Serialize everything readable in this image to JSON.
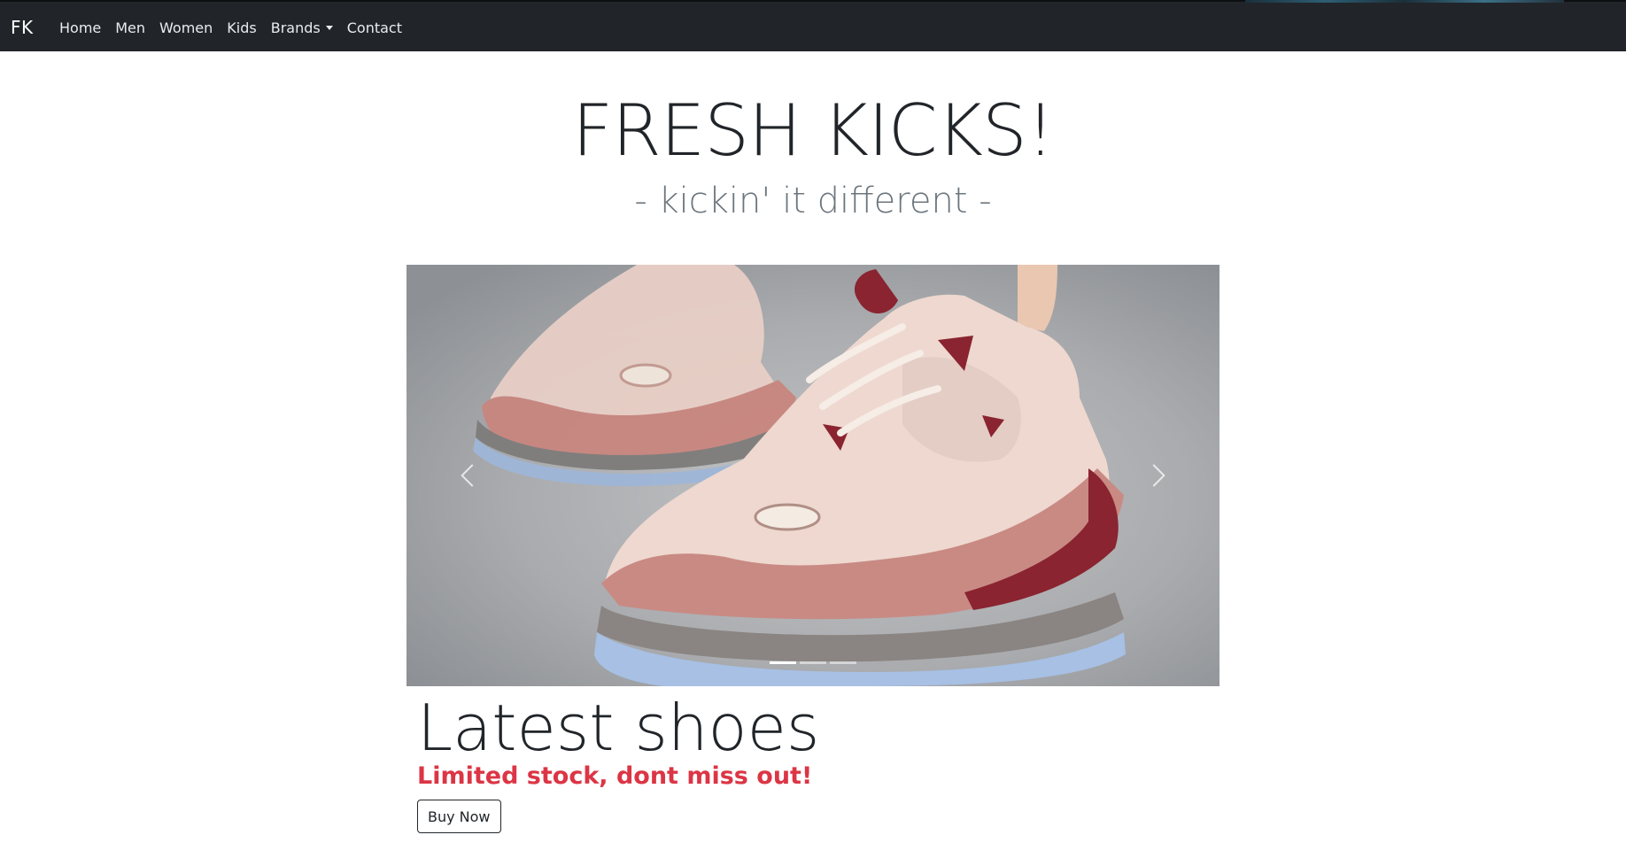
{
  "navbar": {
    "brand": "FK",
    "links": [
      {
        "label": "Home"
      },
      {
        "label": "Men"
      },
      {
        "label": "Women"
      },
      {
        "label": "Kids"
      },
      {
        "label": "Brands"
      },
      {
        "label": "Contact"
      }
    ]
  },
  "hero": {
    "title": "FRESH KICKS!",
    "subtitle": "- kickin' it different -"
  },
  "carousel": {
    "slide_count": 3,
    "active_slide": 1,
    "image_subject": "pink and cream chunky sneakers on concrete",
    "prev_icon": "chevron-left-icon",
    "next_icon": "chevron-right-icon"
  },
  "latest": {
    "title": "Latest shoes",
    "note": "Limited stock, dont miss out!",
    "button_label": "Buy Now"
  },
  "colors": {
    "navbar_bg": "#212529",
    "accent_red": "#dc3545",
    "subtitle_gray": "#6c757d"
  }
}
